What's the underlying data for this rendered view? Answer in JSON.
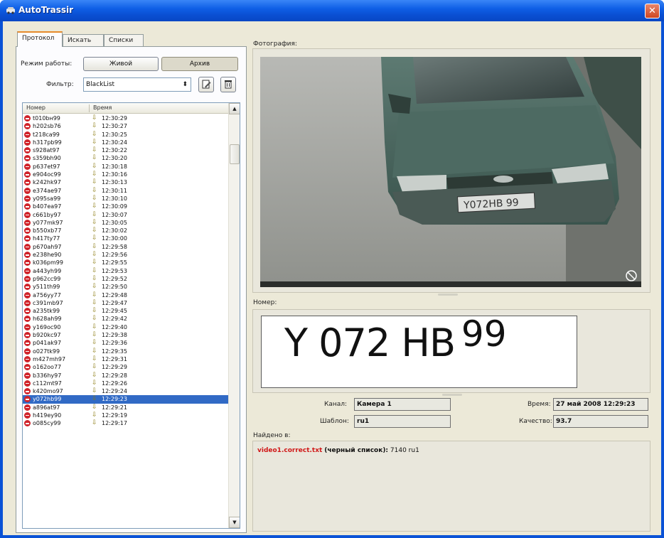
{
  "window": {
    "title": "AutoTrassir",
    "close_glyph": "✕"
  },
  "tabs": [
    {
      "label": "Протокол",
      "active": true
    },
    {
      "label": "Искать",
      "active": false
    },
    {
      "label": "Списки",
      "active": false
    }
  ],
  "mode": {
    "label": "Режим работы:",
    "live_label": "Живой",
    "archive_label": "Архив",
    "selected": "Архив"
  },
  "filter": {
    "label": "Фильтр:",
    "value": "BlackList",
    "arrow_glyph": "⬍",
    "edit_icon": "edit-icon",
    "delete_icon": "trash-icon"
  },
  "list": {
    "col_number": "Номер",
    "col_time": "Время",
    "up_glyph": "▲",
    "down_glyph": "▼",
    "rows": [
      {
        "num": "t010bн99",
        "time": "12:30:29"
      },
      {
        "num": "h202sb76",
        "time": "12:30:27"
      },
      {
        "num": "t218ca99",
        "time": "12:30:25"
      },
      {
        "num": "h317pb99",
        "time": "12:30:24"
      },
      {
        "num": "s928at97",
        "time": "12:30:22"
      },
      {
        "num": "s359bh90",
        "time": "12:30:20"
      },
      {
        "num": "p637et97",
        "time": "12:30:18"
      },
      {
        "num": "e904oc99",
        "time": "12:30:16"
      },
      {
        "num": "k242hk97",
        "time": "12:30:13"
      },
      {
        "num": "e374ae97",
        "time": "12:30:11"
      },
      {
        "num": "y095sa99",
        "time": "12:30:10"
      },
      {
        "num": "b407ea97",
        "time": "12:30:09"
      },
      {
        "num": "c661by97",
        "time": "12:30:07"
      },
      {
        "num": "y077mk97",
        "time": "12:30:05"
      },
      {
        "num": "b550xb77",
        "time": "12:30:02"
      },
      {
        "num": "h417ty77",
        "time": "12:30:00"
      },
      {
        "num": "p670ah97",
        "time": "12:29:58"
      },
      {
        "num": "e238he90",
        "time": "12:29:56"
      },
      {
        "num": "k036pm99",
        "time": "12:29:55"
      },
      {
        "num": "a443yh99",
        "time": "12:29:53"
      },
      {
        "num": "p962cc99",
        "time": "12:29:52"
      },
      {
        "num": "y511th99",
        "time": "12:29:50"
      },
      {
        "num": "a756yy77",
        "time": "12:29:48"
      },
      {
        "num": "c391mb97",
        "time": "12:29:47"
      },
      {
        "num": "a235tk99",
        "time": "12:29:45"
      },
      {
        "num": "h628ah99",
        "time": "12:29:42"
      },
      {
        "num": "y169oc90",
        "time": "12:29:40"
      },
      {
        "num": "b920kc97",
        "time": "12:29:38"
      },
      {
        "num": "p041ak97",
        "time": "12:29:36"
      },
      {
        "num": "o027tk99",
        "time": "12:29:35"
      },
      {
        "num": "m427mh97",
        "time": "12:29:31"
      },
      {
        "num": "o162oo77",
        "time": "12:29:29"
      },
      {
        "num": "b336hy97",
        "time": "12:29:28"
      },
      {
        "num": "c112mt97",
        "time": "12:29:26"
      },
      {
        "num": "k420mo97",
        "time": "12:29:24"
      },
      {
        "num": "y072hb99",
        "time": "12:29:23",
        "selected": true
      },
      {
        "num": "a896at97",
        "time": "12:29:21"
      },
      {
        "num": "h419ey90",
        "time": "12:29:19"
      },
      {
        "num": "o085cy99",
        "time": "12:29:17"
      }
    ]
  },
  "photo": {
    "label": "Фотография:",
    "plate_on_car": "Y072HB 99"
  },
  "number": {
    "label": "Номер:",
    "plate_main": "Y 072 HB",
    "plate_region": "99"
  },
  "details": {
    "channel_label": "Канал:",
    "channel_value": "Камера 1",
    "time_label": "Время:",
    "time_value": "27 май 2008 12:29:23",
    "template_label": "Шаблон:",
    "template_value": "ru1",
    "quality_label": "Качество:",
    "quality_value": "93.7"
  },
  "found": {
    "label": "Найдено в:",
    "file": "video1.correct.txt",
    "list_name": "(черный список):",
    "entry": "7140 ru1"
  },
  "colors": {
    "accent_red": "#d0232a",
    "selection": "#316ac5",
    "found_file": "#d01818"
  }
}
